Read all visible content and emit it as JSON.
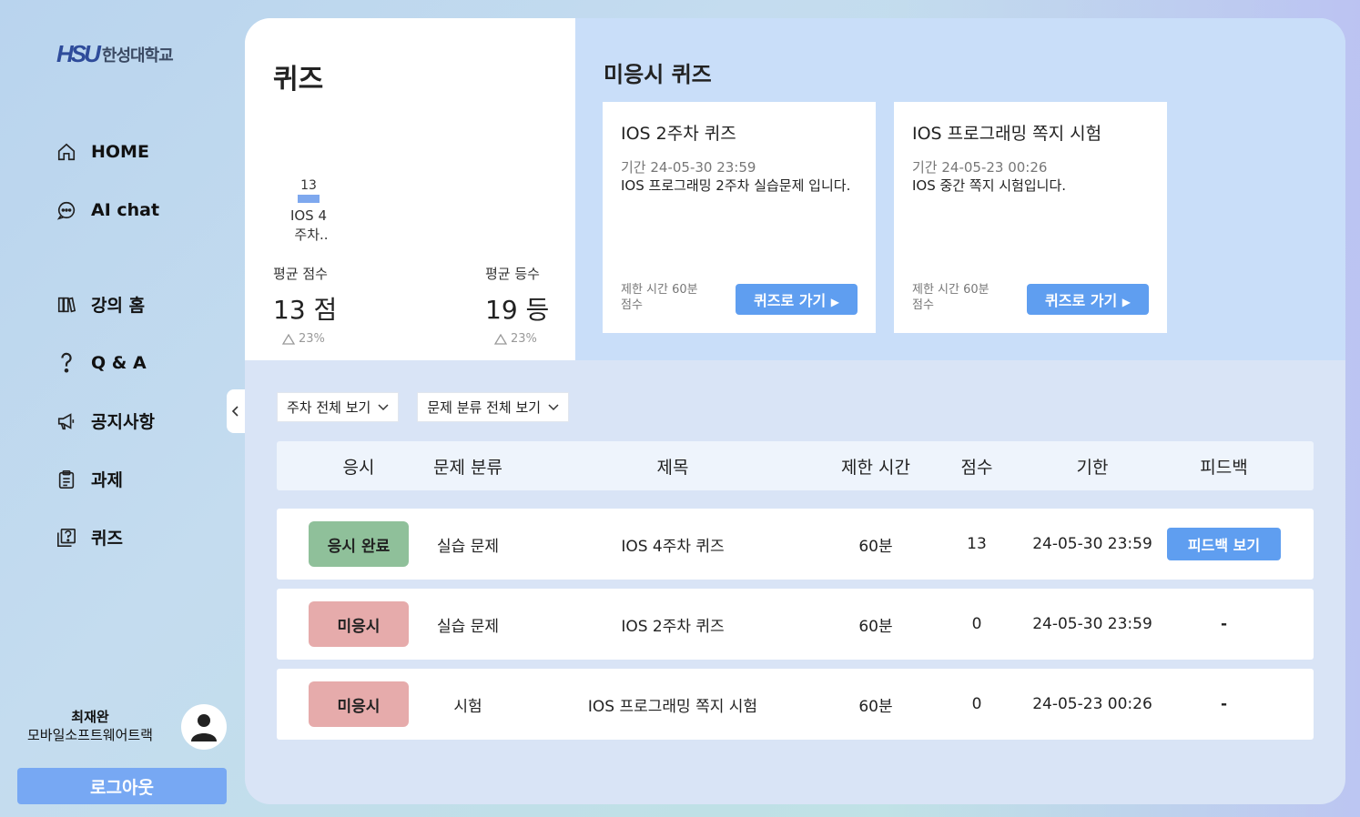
{
  "sidebar": {
    "logo_mark": "HSU",
    "logo_name": "한성대학교",
    "items": [
      {
        "label": "HOME"
      },
      {
        "label": "AI chat"
      },
      {
        "label": "강의 홈"
      },
      {
        "label": "Q & A"
      },
      {
        "label": "공지사항"
      },
      {
        "label": "과제"
      },
      {
        "label": "퀴즈"
      }
    ],
    "user_name": "최재완",
    "user_track": "모바일소프트웨어트랙",
    "logout_label": "로그아웃"
  },
  "summary": {
    "title": "퀴즈",
    "chart_data": {
      "type": "bar",
      "categories": [
        "IOS 4 주차.."
      ],
      "values": [
        13
      ]
    },
    "chart_val": "13",
    "chart_cat_line1": "IOS 4",
    "chart_cat_line2": "주차..",
    "avg_score_label": "평균 점수",
    "avg_score_value": "13 점",
    "avg_score_delta": "23%",
    "avg_rank_label": "평균 등수",
    "avg_rank_value": "19 등",
    "avg_rank_delta": "23%"
  },
  "pending": {
    "title": "미응시 퀴즈",
    "cards": [
      {
        "title": "IOS 2주차 퀴즈",
        "period": "기간  24-05-30 23:59",
        "desc": "IOS 프로그래밍 2주차 실습문제 입니다.",
        "time_limit": "제한 시간   60분",
        "score": "점수",
        "button": "퀴즈로 가기"
      },
      {
        "title": "IOS 프로그래밍 쪽지 시험",
        "period": "기간  24-05-23 00:26",
        "desc": "IOS 중간 쪽지 시험입니다.",
        "time_limit": "제한 시간   60분",
        "score": "점수",
        "button": "퀴즈로 가기"
      }
    ]
  },
  "filters": {
    "week": "주차 전체 보기",
    "category": "문제 분류 전체 보기"
  },
  "table": {
    "headers": [
      "응시",
      "문제 분류",
      "제목",
      "제한 시간",
      "점수",
      "기한",
      "피드백"
    ],
    "rows": [
      {
        "status": "응시 완료",
        "status_color": "#8fc09a",
        "category": "실습 문제",
        "title": "IOS 4주차 퀴즈",
        "time": "60분",
        "score": "13",
        "deadline": "24-05-30 23:59",
        "feedback": "피드백 보기"
      },
      {
        "status": "미응시",
        "status_color": "#e6abab",
        "category": "실습 문제",
        "title": "IOS 2주차 퀴즈",
        "time": "60분",
        "score": "0",
        "deadline": "24-05-30 23:59",
        "feedback": "-"
      },
      {
        "status": "미응시",
        "status_color": "#e6abab",
        "category": "시험",
        "title": "IOS 프로그래밍 쪽지 시험",
        "time": "60분",
        "score": "0",
        "deadline": "24-05-23 00:26",
        "feedback": "-"
      }
    ]
  },
  "colors": {
    "accent": "#5f9ef0",
    "done": "#8fc09a",
    "pending": "#e6abab"
  }
}
